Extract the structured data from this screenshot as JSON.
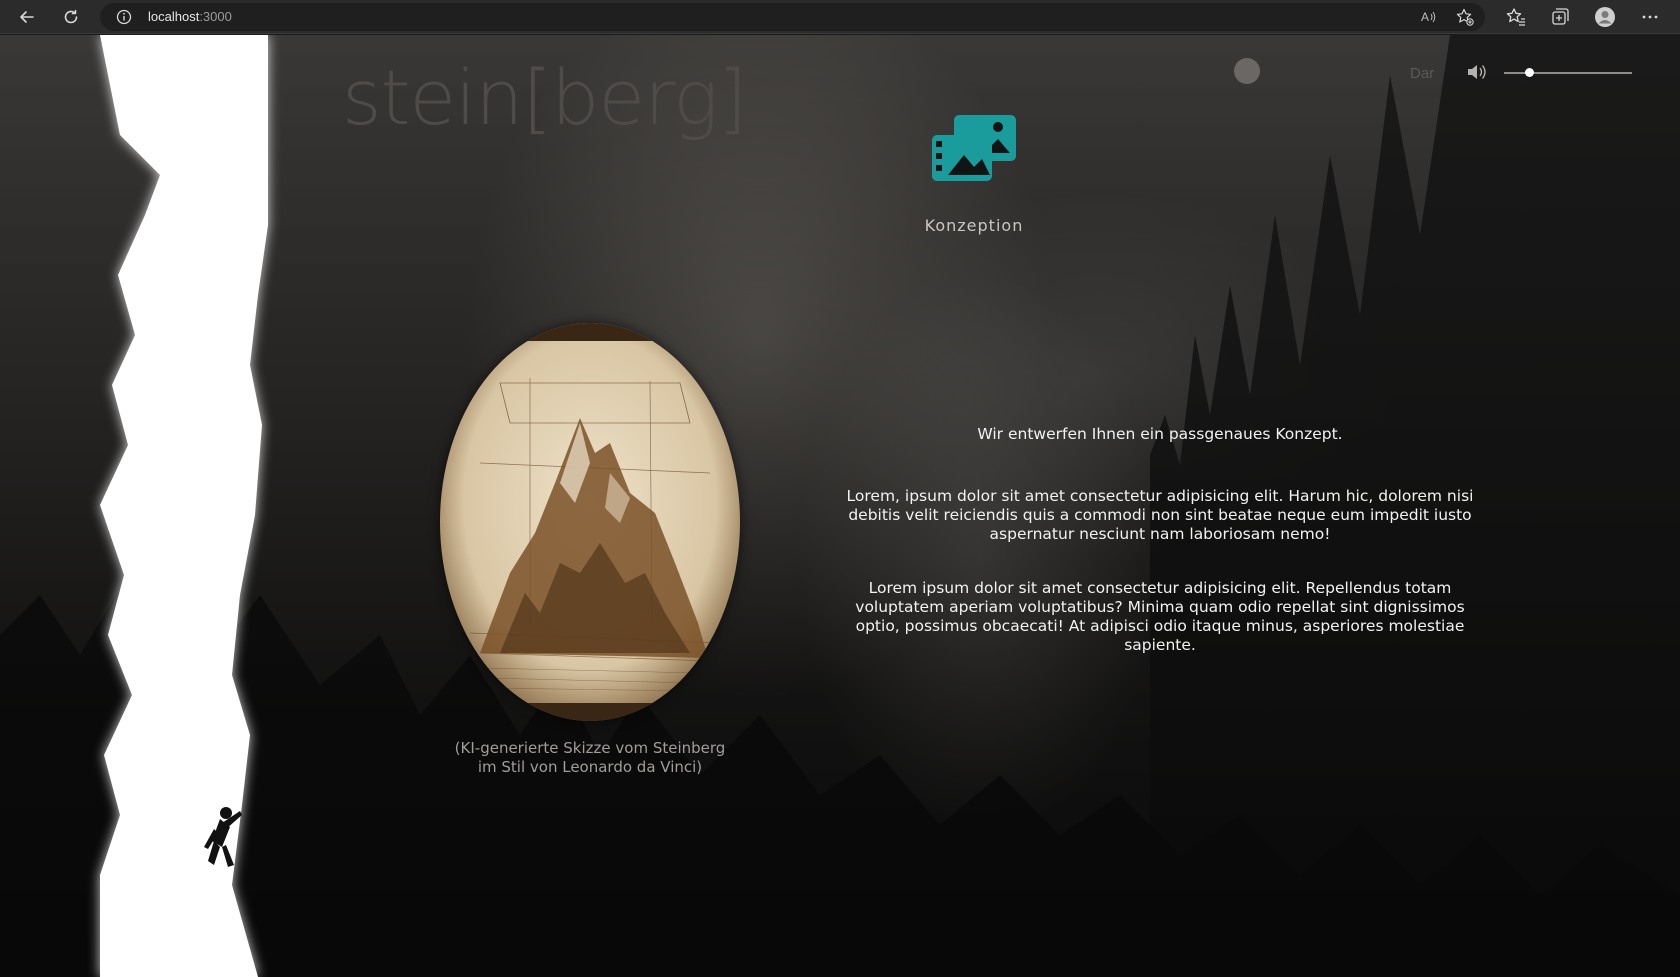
{
  "browser": {
    "url_host": "localhost",
    "url_port": ":3000",
    "icons": [
      "back-icon",
      "reload-icon",
      "info-icon",
      "read-aloud-icon",
      "add-favorite-icon",
      "favorites-icon",
      "collections-icon",
      "profile-icon",
      "more-icon"
    ]
  },
  "header": {
    "logo": "stein[berg]",
    "lang_label": "Dar",
    "audio": {
      "volume": 0.2
    }
  },
  "service": {
    "icon": "media-gallery-icon",
    "title": "Konzeption",
    "accent_color": "#1a9c9c"
  },
  "image": {
    "caption_line1": "(KI-generierte Skizze vom Steinberg",
    "caption_line2": "im Stil von Leonardo da Vinci)"
  },
  "content": {
    "lead": "Wir entwerfen Ihnen ein passgenaues Konzept.",
    "paragraph1": "Lorem, ipsum dolor sit amet consectetur adipisicing elit. Harum hic, dolorem nisi debitis velit reiciendis quis a commodi non sint beatae neque eum impedit iusto aspernatur nesciunt nam laboriosam nemo!",
    "paragraph2": "Lorem ipsum dolor sit amet consectetur adipisicing elit. Repellendus totam voluptatem aperiam voluptatibus? Minima quam odio repellat sint dignissimos optio, possimus obcaecati! At adipisci odio itaque minus, asperiores molestiae sapiente."
  }
}
